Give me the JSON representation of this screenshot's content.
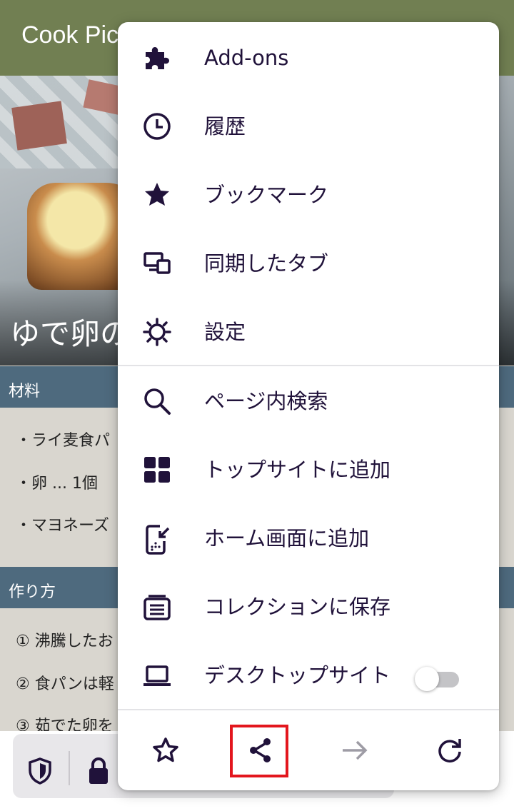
{
  "app": {
    "title": "Cook Pic"
  },
  "hero": {
    "title": "ゆで卵の"
  },
  "sections": {
    "ingredients_title": "材料",
    "ingredients": [
      "・ライ麦食パ",
      "・卵 ... 1個",
      "・マヨネーズ"
    ],
    "steps_title": "作り方",
    "steps": [
      "① 沸騰したお",
      "② 食パンは軽",
      "③ 茹でた卵を"
    ]
  },
  "menu": {
    "items": [
      {
        "label": "Add-ons",
        "icon": "puzzle-icon"
      },
      {
        "label": "履歴",
        "icon": "clock-icon"
      },
      {
        "label": "ブックマーク",
        "icon": "star-filled-icon"
      },
      {
        "label": "同期したタブ",
        "icon": "synced-devices-icon"
      },
      {
        "label": "設定",
        "icon": "gear-icon"
      },
      {
        "label": "ページ内検索",
        "icon": "search-icon"
      },
      {
        "label": "トップサイトに追加",
        "icon": "grid-icon"
      },
      {
        "label": "ホーム画面に追加",
        "icon": "add-to-home-icon"
      },
      {
        "label": "コレクションに保存",
        "icon": "collection-icon"
      },
      {
        "label": "デスクトップサイト",
        "icon": "laptop-icon",
        "toggle": false
      }
    ],
    "actions": [
      {
        "name": "bookmark",
        "icon": "star-outline-icon"
      },
      {
        "name": "share",
        "icon": "share-icon",
        "highlighted": true
      },
      {
        "name": "forward",
        "icon": "arrow-forward-icon",
        "disabled": true
      },
      {
        "name": "reload",
        "icon": "reload-icon"
      }
    ]
  },
  "colors": {
    "appbar": "#717f52",
    "section_bar": "#4e6a7e",
    "menu_text": "#20123a",
    "highlight": "#e3161d"
  }
}
